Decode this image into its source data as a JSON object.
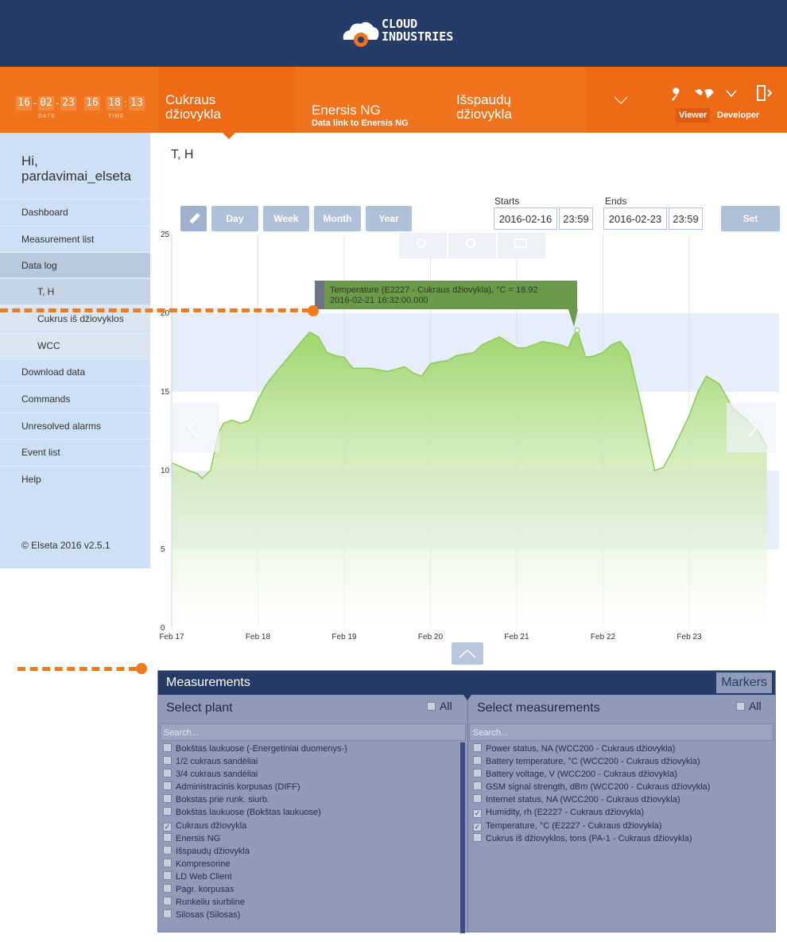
{
  "brand": {
    "line1": "CLOUD",
    "line2": "INDUSTRIES"
  },
  "clock": {
    "date": [
      "16",
      "02",
      "23"
    ],
    "time": [
      "16",
      "18",
      "13"
    ],
    "date_label": "DATE",
    "time_label": "TIME"
  },
  "nav": {
    "tabs": [
      {
        "line1": "Cukraus",
        "line2": "džiovykla",
        "sub": ""
      },
      {
        "line1": "Enersis NG",
        "line2": "",
        "sub": "Data link to Enersis NG"
      },
      {
        "line1": "Išspaudų",
        "line2": "džiovykla",
        "sub": ""
      }
    ],
    "role_viewer": "Viewer",
    "role_developer": "Developer"
  },
  "sidebar": {
    "greeting_line1": "Hi,",
    "greeting_line2": "pardavimai_elseta",
    "items": [
      "Dashboard",
      "Measurement list",
      "Data log",
      "T, H",
      "Cukrus iš džiovyklos",
      "WCC",
      "Download data",
      "Commands",
      "Unresolved alarms",
      "Event list",
      "Help"
    ],
    "copyright": "© Elseta 2016 v2.5.1"
  },
  "main": {
    "title": "T, H",
    "buttons": {
      "day": "Day",
      "week": "Week",
      "month": "Month",
      "year": "Year",
      "set": "Set"
    },
    "starts_label": "Starts",
    "starts_date": "2016-02-16",
    "starts_time": "23:59",
    "ends_label": "Ends",
    "ends_date": "2016-02-23",
    "ends_time": "23:59"
  },
  "chart_data": {
    "type": "area",
    "title": "",
    "xlabel": "",
    "ylabel": "",
    "ylim": [
      0,
      25
    ],
    "yticks": [
      0,
      5,
      10,
      15,
      20,
      25
    ],
    "xticks": [
      "Feb 17",
      "Feb 18",
      "Feb 19",
      "Feb 20",
      "Feb 21",
      "Feb 22",
      "Feb 23"
    ],
    "xlim": [
      0,
      6.9
    ],
    "series": [
      {
        "x": [
          0,
          0.2,
          0.3,
          0.35,
          0.45,
          0.55,
          0.6,
          0.7,
          0.8,
          0.9,
          1.0,
          1.1,
          1.2,
          1.4,
          1.55,
          1.6,
          1.7,
          1.8,
          1.9,
          2.0,
          2.1,
          2.3,
          2.5,
          2.7,
          2.8,
          2.9,
          3.0,
          3.2,
          3.3,
          3.5,
          3.6,
          3.8,
          4.0,
          4.1,
          4.3,
          4.5,
          4.6,
          4.65,
          4.7,
          4.8,
          4.9,
          5.0,
          5.1,
          5.2,
          5.3,
          5.45,
          5.6,
          5.7,
          5.8,
          6.0,
          6.1,
          6.2,
          6.35,
          6.5,
          6.6,
          6.75,
          6.85,
          6.9
        ],
        "values": [
          10.5,
          10.0,
          9.8,
          9.5,
          10.0,
          12.5,
          13.0,
          13.2,
          13.0,
          13.2,
          14.5,
          15.5,
          16.2,
          17.5,
          18.5,
          18.8,
          18.5,
          17.5,
          17.3,
          17.2,
          16.5,
          16.5,
          16.3,
          16.6,
          16.2,
          16.0,
          16.8,
          17.0,
          17.3,
          17.5,
          18.0,
          18.5,
          17.8,
          17.8,
          18.2,
          18.0,
          17.8,
          18.5,
          18.92,
          17.2,
          17.3,
          17.5,
          18.0,
          18.2,
          17.5,
          14.0,
          10.0,
          10.2,
          11.2,
          13.5,
          15.0,
          16.0,
          15.5,
          14.0,
          13.5,
          13.0,
          12.0,
          11.5
        ],
        "color": "#9fd66b"
      }
    ],
    "tooltip_line1": "Temperature (E2227 - Cukraus džiovykla), °C = 18.92",
    "tooltip_line2": "2016-02-21 16:32:00.000"
  },
  "measurements": {
    "title": "Measurements",
    "markers_label": "Markers",
    "plant_header": "Select plant",
    "meas_header": "Select measurements",
    "all_label": "All",
    "search_placeholder": "Search...",
    "plants": [
      {
        "label": "Bokštas laukuose (-Energetiniai duomenys-)",
        "checked": false
      },
      {
        "label": "1/2 cukraus sandėliai",
        "checked": false
      },
      {
        "label": "3/4 cukraus sandėliai",
        "checked": false
      },
      {
        "label": "Administracinis korpusas (DIFF)",
        "checked": false
      },
      {
        "label": "Bokstas prie runk. siurb.",
        "checked": false
      },
      {
        "label": "Bokštas laukuose (Bokštas laukuose)",
        "checked": false
      },
      {
        "label": "Cukraus džiovykla",
        "checked": true
      },
      {
        "label": "Enersis NG",
        "checked": false
      },
      {
        "label": "Išspaudų džiovykla",
        "checked": false
      },
      {
        "label": "Kompresorine",
        "checked": false
      },
      {
        "label": "LD Web Client",
        "checked": false
      },
      {
        "label": "Pagr. korpusas",
        "checked": false
      },
      {
        "label": "Runkeliu siurbline",
        "checked": false
      },
      {
        "label": "Silosas (Silosas)",
        "checked": false
      }
    ],
    "measurements": [
      {
        "label": "Power status, NA (WCC200 - Cukraus džiovykla)",
        "checked": false
      },
      {
        "label": "Battery temperature, °C (WCC200 - Cukraus džiovykla)",
        "checked": false
      },
      {
        "label": "Battery voltage, V (WCC200 - Cukraus džiovykla)",
        "checked": false
      },
      {
        "label": "GSM signal strength, dBm (WCC200 - Cukraus džiovykla)",
        "checked": false
      },
      {
        "label": "Internet status, NA (WCC200 - Cukraus džiovykla)",
        "checked": false
      },
      {
        "label": "Humidity, rh (E2227 - Cukraus džiovykla)",
        "checked": true
      },
      {
        "label": "Temperature, °C (E2227 - Cukraus džiovykla)",
        "checked": true
      },
      {
        "label": "Cukrus iš džiovyklos, tons (PA-1 - Cukraus džiovykla)",
        "checked": false
      }
    ]
  }
}
